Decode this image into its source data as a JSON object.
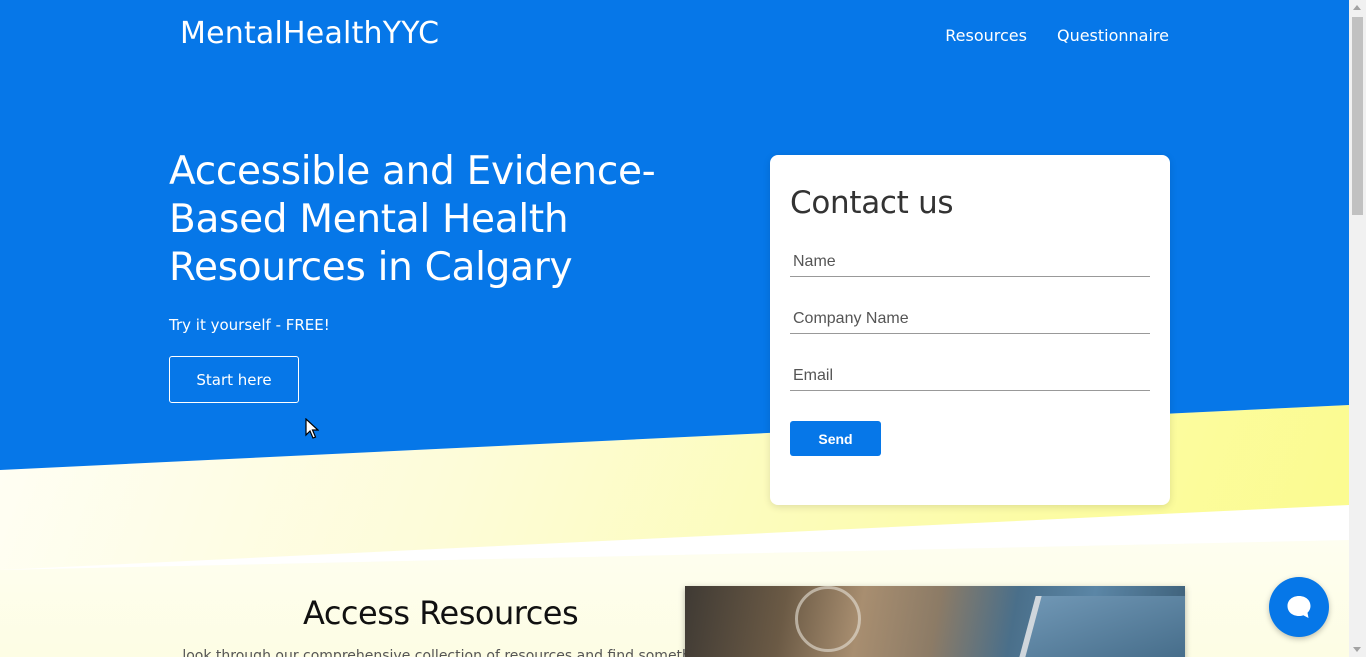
{
  "header": {
    "brand": "MentalHealthYYC",
    "nav": [
      {
        "label": "Resources"
      },
      {
        "label": "Questionnaire"
      }
    ]
  },
  "hero": {
    "title": "Accessible and Evidence-Based Mental Health Resources in Calgary",
    "subtitle": "Try it yourself - FREE!",
    "cta_label": "Start here"
  },
  "contact": {
    "title": "Contact us",
    "name_placeholder": "Name",
    "company_placeholder": "Company Name",
    "email_placeholder": "Email",
    "send_label": "Send"
  },
  "access": {
    "title": "Access Resources",
    "text": "...look through our comprehensive collection of resources and find something..."
  },
  "colors": {
    "primary": "#0677e8",
    "accent_yellow": "#fbfb8e",
    "card_bg": "#ffffff"
  },
  "icons": {
    "chat": "chat-bubble-icon",
    "cursor": "mouse-cursor-icon"
  }
}
